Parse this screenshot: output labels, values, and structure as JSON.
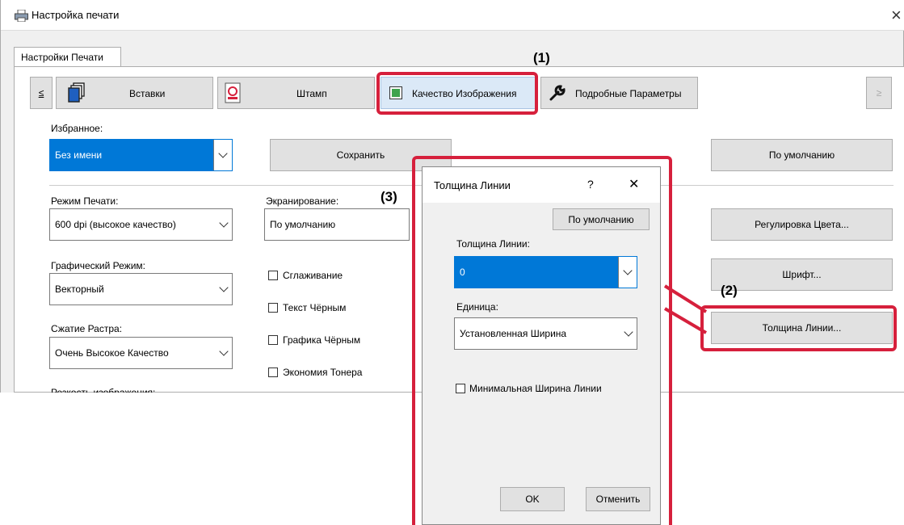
{
  "window": {
    "title": "Настройка печати",
    "close_glyph": "×",
    "tab_label": "Настройки Печати"
  },
  "toolbar": {
    "prev_label": "≤",
    "next_label": "≥",
    "tabs": [
      {
        "label": "Вставки",
        "icon": "pages-icon"
      },
      {
        "label": "Штамп",
        "icon": "stamp-icon"
      },
      {
        "label": "Качество Изображения",
        "icon": "image-quality-icon"
      },
      {
        "label": "Подробные Параметры",
        "icon": "wrench-icon"
      }
    ]
  },
  "favorites": {
    "label": "Избранное:",
    "value": "Без имени",
    "save_label": "Сохранить",
    "default_label": "По умолчанию"
  },
  "print_mode": {
    "label": "Режим Печати:",
    "value": "600 dpi (высокое качество)"
  },
  "screening": {
    "label": "Экранирование:",
    "value": "По умолчанию"
  },
  "graphics_mode": {
    "label": "Графический Режим:",
    "value": "Векторный"
  },
  "raster_compression": {
    "label": "Сжатие Растра:",
    "value": "Очень Высокое Качество"
  },
  "image_sharpness": {
    "label": "Резкость изображения:"
  },
  "checkboxes": [
    "Сглаживание",
    "Текст Чёрным",
    "Графика Чёрным",
    "Экономия Тонера"
  ],
  "right_buttons": {
    "color_adjust": "Регулировка Цвета...",
    "font": "Шрифт...",
    "line_width": "Толщина Линии..."
  },
  "dialog": {
    "title": "Толщина Линии",
    "help": "?",
    "close": "✕",
    "default_label": "По умолчанию",
    "width_label": "Толщина Линии:",
    "width_value": "0",
    "unit_label": "Единица:",
    "unit_value": "Установленная Ширина",
    "min_width_label": "Минимальная Ширина Линии",
    "ok_label": "OK",
    "cancel_label": "Отменить"
  },
  "callouts": {
    "c1": "(1)",
    "c2": "(2)",
    "c3": "(3)"
  },
  "colors": {
    "highlight": "#d6203c",
    "selection": "#0078d7"
  }
}
